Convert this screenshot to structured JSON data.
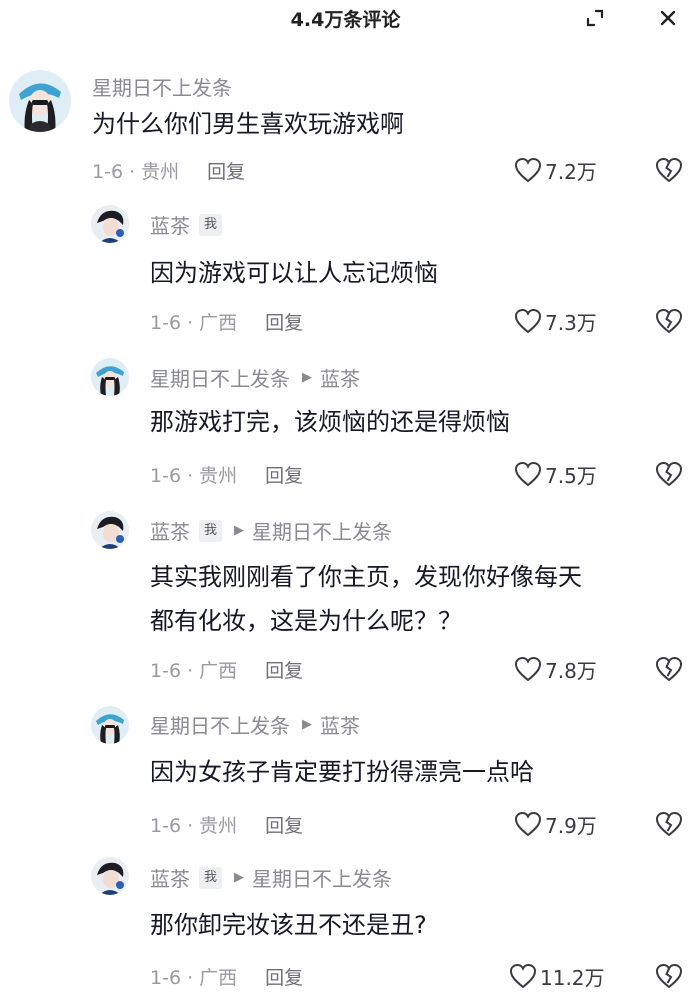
{
  "header": {
    "title": "4.4万条评论",
    "expand_icon": "expand-icon",
    "close_icon": "close-icon"
  },
  "comments": [
    {
      "author": "星期日不上发条",
      "text": "为什么你们男生喜欢玩游戏啊",
      "date_location": "1-6 · 贵州",
      "reply_label": "回复",
      "likes": "7.2万"
    },
    {
      "author": "蓝茶",
      "badge": "我",
      "text": "因为游戏可以让人忘记烦恼",
      "date_location": "1-6 · 广西",
      "reply_label": "回复",
      "likes": "7.3万"
    },
    {
      "author": "星期日不上发条",
      "reply_to": "蓝茶",
      "text": "那游戏打完，该烦恼的还是得烦恼",
      "date_location": "1-6 · 贵州",
      "reply_label": "回复",
      "likes": "7.5万"
    },
    {
      "author": "蓝茶",
      "badge": "我",
      "reply_to": "星期日不上发条",
      "text_line1": "其实我刚刚看了你主页，发现你好像每天",
      "text_line2": "都有化妆，这是为什么呢？？",
      "date_location": "1-6 · 广西",
      "reply_label": "回复",
      "likes": "7.8万"
    },
    {
      "author": "星期日不上发条",
      "reply_to": "蓝茶",
      "text": "因为女孩子肯定要打扮得漂亮一点哈",
      "date_location": "1-6 · 贵州",
      "reply_label": "回复",
      "likes": "7.9万"
    },
    {
      "author": "蓝茶",
      "badge": "我",
      "reply_to": "星期日不上发条",
      "text": "那你卸完妆该丑不还是丑?",
      "date_location": "1-6 · 广西",
      "reply_label": "回复",
      "likes": "11.2万"
    }
  ]
}
